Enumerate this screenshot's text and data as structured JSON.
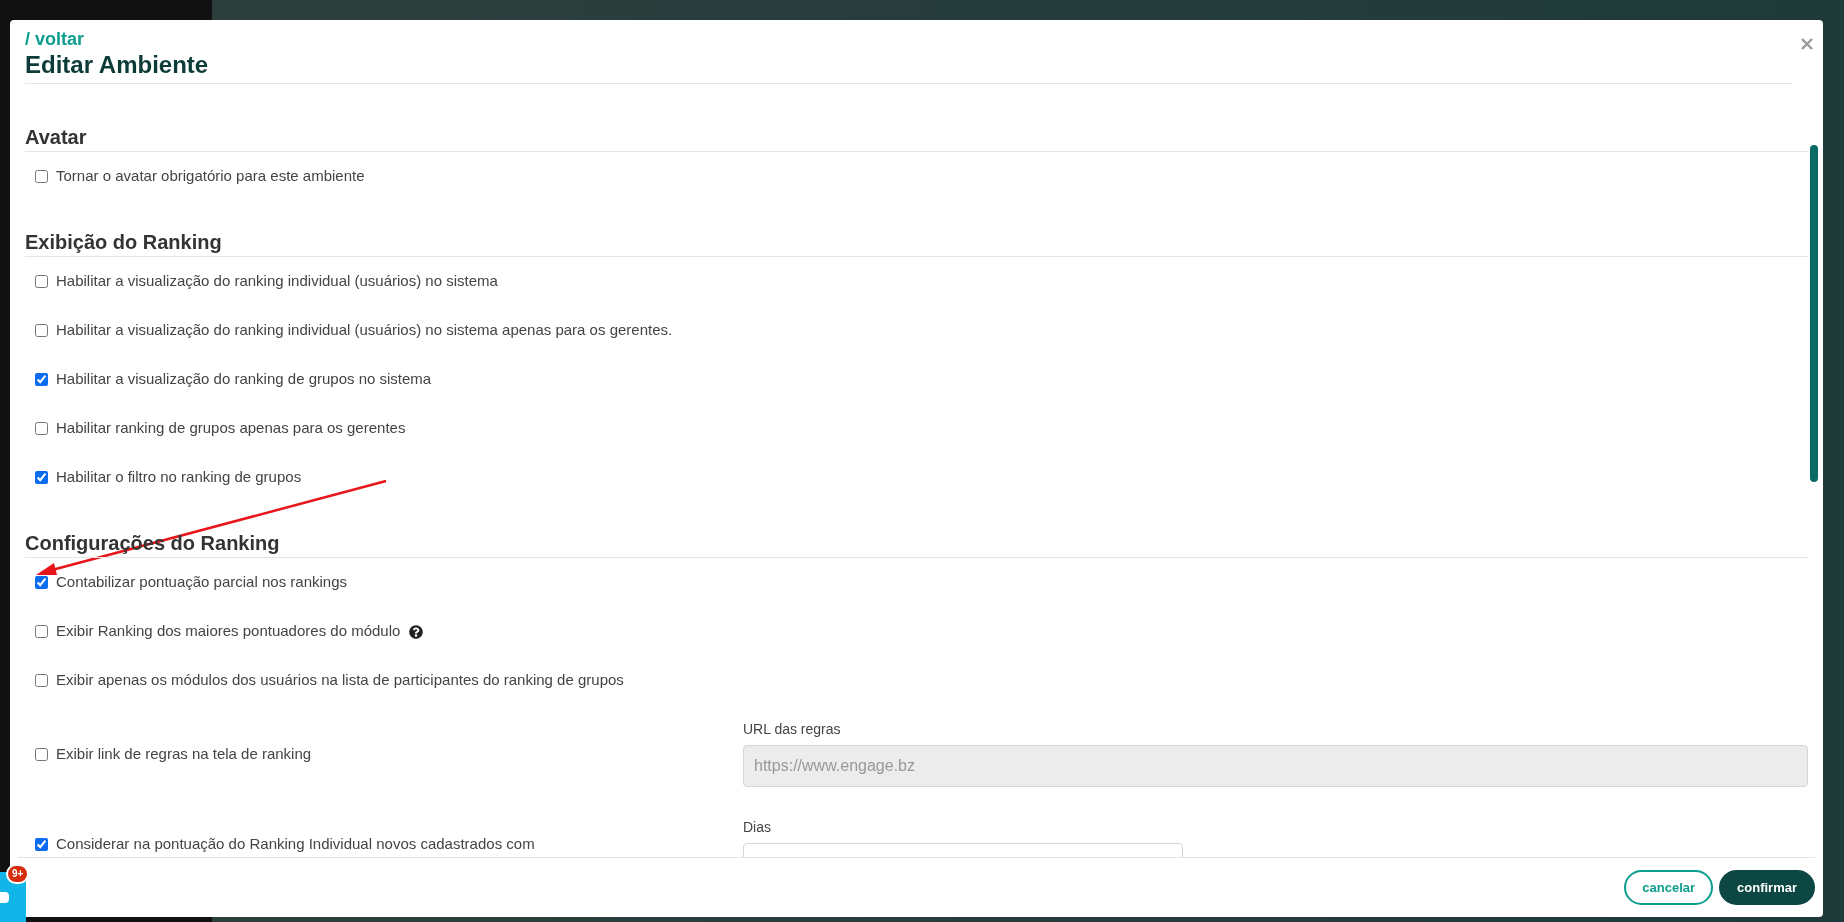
{
  "header": {
    "back_link": "/ voltar",
    "title": "Editar Ambiente"
  },
  "sections": [
    {
      "title": "Avatar",
      "options": [
        {
          "kind": "plain",
          "label": "Tornar o avatar obrigatório para este ambiente",
          "checked": false
        }
      ]
    },
    {
      "title": "Exibição do Ranking",
      "options": [
        {
          "kind": "plain",
          "label": "Habilitar a visualização do ranking individual (usuários) no sistema",
          "checked": false
        },
        {
          "kind": "plain",
          "label": "Habilitar a visualização do ranking individual (usuários) no sistema apenas para os gerentes.",
          "checked": false
        },
        {
          "kind": "plain",
          "label": "Habilitar a visualização do ranking de grupos no sistema",
          "checked": true
        },
        {
          "kind": "plain",
          "label": "Habilitar ranking de grupos apenas para os gerentes",
          "checked": false
        },
        {
          "kind": "plain",
          "label": "Habilitar o filtro no ranking de grupos",
          "checked": true
        }
      ]
    },
    {
      "title": "Configurações do Ranking",
      "options": [
        {
          "kind": "plain",
          "label": "Contabilizar pontuação parcial nos rankings",
          "checked": true
        },
        {
          "kind": "help",
          "label": "Exibir Ranking dos maiores pontuadores do módulo",
          "checked": false
        },
        {
          "kind": "plain",
          "label": "Exibir apenas os módulos dos usuários na lista de participantes do ranking de grupos",
          "checked": false
        },
        {
          "kind": "field",
          "label": "Exibir link de regras na tela de ranking",
          "checked": false,
          "field": {
            "label": "URL das regras",
            "value": "https://www.engage.bz",
            "disabled": true,
            "kind": "wide"
          }
        },
        {
          "kind": "field",
          "label": "Considerar na pontuação do Ranking Individual novos cadastrados com",
          "checked": true,
          "field": {
            "label": "Dias",
            "disabled": false,
            "kind": "narrow"
          }
        }
      ]
    }
  ],
  "footer": {
    "buttons": [
      {
        "kind": "secondary",
        "label": "cancelar"
      },
      {
        "kind": "primary",
        "label": "confirmar"
      }
    ]
  },
  "chat": {
    "badge": "9+"
  }
}
